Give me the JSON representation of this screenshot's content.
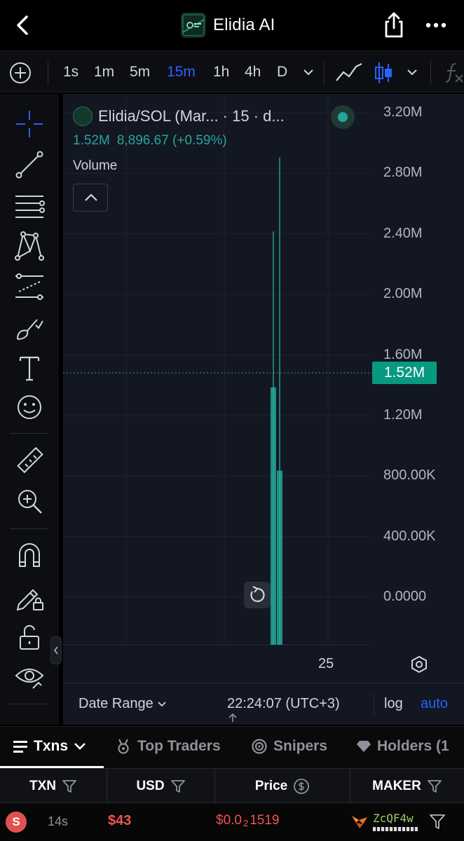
{
  "nav": {
    "title": "Elidia AI"
  },
  "intervals": [
    {
      "label": "1s",
      "active": false
    },
    {
      "label": "1m",
      "active": false
    },
    {
      "label": "5m",
      "active": false
    },
    {
      "label": "15m",
      "active": true
    },
    {
      "label": "1h",
      "active": false
    },
    {
      "label": "4h",
      "active": false
    },
    {
      "label": "D",
      "active": false
    }
  ],
  "chart": {
    "symbol": "Elidia/SOL (Mar... · 15 · d...",
    "ohlc_volume": "1.52M",
    "ohlc_price": "8,896.67 (+0.59%)",
    "study_label": "Volume",
    "current_value_label": "1.52M",
    "x_tick_label": "25"
  },
  "chart_data": {
    "type": "bar",
    "title": "Volume",
    "y_ticks": [
      "3.20M",
      "2.80M",
      "2.40M",
      "2.00M",
      "1.60M",
      "1.20M",
      "800.00K",
      "400.00K",
      "0.0000"
    ],
    "ylim": [
      0,
      3200000
    ],
    "x_ticks": [
      "25"
    ],
    "current_value": 1520000,
    "grid": true,
    "bars": [
      {
        "low": 0,
        "high": 2550000,
        "open": 0,
        "close": 1520000,
        "color": "#26a69a"
      },
      {
        "low": 0,
        "high": 3040000,
        "open": 0,
        "close": 970000,
        "color": "#26a69a"
      }
    ]
  },
  "bottom_bar": {
    "date_range": "Date Range",
    "clock": "22:24:07 (UTC+3)",
    "log": "log",
    "auto": "auto"
  },
  "tabs": [
    {
      "label": "Txns",
      "active": true
    },
    {
      "label": "Top Traders",
      "active": false
    },
    {
      "label": "Snipers",
      "active": false
    },
    {
      "label": "Holders (1",
      "active": false
    }
  ],
  "table": {
    "columns": [
      "TXN",
      "USD",
      "Price",
      "MAKER"
    ],
    "rows": [
      {
        "type": "S",
        "age": "14s",
        "usd": "$43",
        "price_prefix": "$0.0",
        "price_zeros": "2",
        "price_digits": "1519",
        "maker": "ZcQF4w"
      }
    ]
  },
  "colors": {
    "up": "#26a69a",
    "down": "#ef5350",
    "accent": "#2962ff",
    "background": "#131722"
  }
}
